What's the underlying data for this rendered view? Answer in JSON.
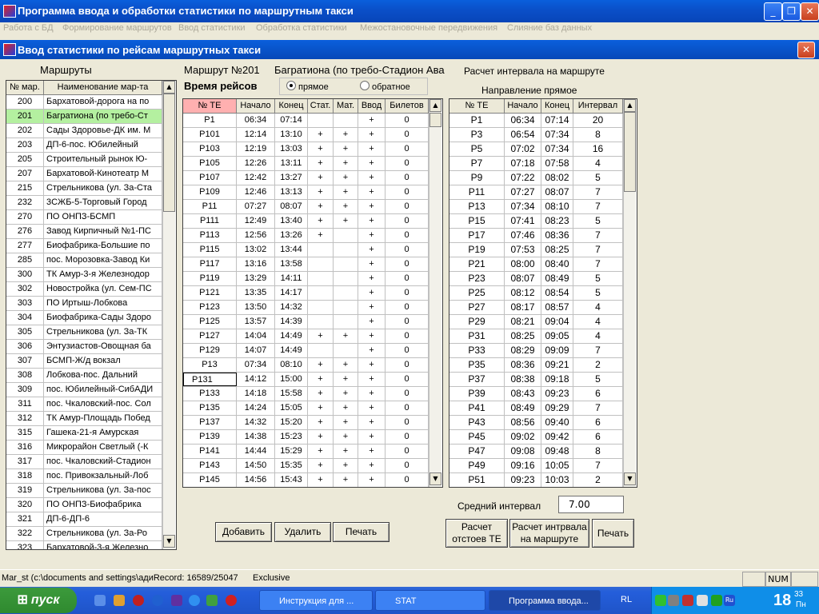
{
  "app": {
    "title": "Программа ввода и обработки статистики по маршрутным такси",
    "menu": [
      "Работа с БД",
      "Формирование маршрутов",
      "Ввод статистики",
      "Обработка статистики",
      "Межостановочные передвижения",
      "Слияние баз данных"
    ]
  },
  "child": {
    "title": "Ввод статистики по рейсам маршрутных такси"
  },
  "routes": {
    "label": "Маршруты",
    "col_num": "№ мар.",
    "col_name": "Наименование мар-та",
    "selected_index": 1,
    "items": [
      [
        "200",
        "Бархатовой-дорога на по"
      ],
      [
        "201",
        "Багратиона (по требо-Ст"
      ],
      [
        "202",
        "Сады Здоровье-ДК им. М"
      ],
      [
        "203",
        "ДП-6-пос. Юбилейный"
      ],
      [
        "205",
        "Строительный рынок Ю-"
      ],
      [
        "207",
        "Бархатовой-Кинотеатр М"
      ],
      [
        "215",
        "Стрельникова (ул. За-Ста"
      ],
      [
        "232",
        "3СЖБ-5-Торговый Город"
      ],
      [
        "270",
        "ПО ОНПЗ-БСМП"
      ],
      [
        "276",
        "Завод Кирпичный №1-ПС"
      ],
      [
        "277",
        "Биофабрика-Большие по"
      ],
      [
        "285",
        "пос. Морозовка-Завод Ки"
      ],
      [
        "300",
        "ТК Амур-3-я Железнодор"
      ],
      [
        "302",
        "Новостройка (ул. Сем-ПС"
      ],
      [
        "303",
        "ПО Иртыш-Лобкова"
      ],
      [
        "304",
        "Биофабрика-Сады Здоро"
      ],
      [
        "305",
        "Стрельникова (ул. За-ТК"
      ],
      [
        "306",
        "Энтузиастов-Овощная ба"
      ],
      [
        "307",
        "БСМП-Ж/д вокзал"
      ],
      [
        "308",
        "Лобкова-пос. Дальний"
      ],
      [
        "309",
        "пос. Юбилейный-СибАДИ"
      ],
      [
        "311",
        "пос. Чкаловский-пос. Сол"
      ],
      [
        "312",
        "ТК Амур-Площадь Побед"
      ],
      [
        "315",
        "Гашека-21-я Амурская"
      ],
      [
        "316",
        "Микрорайон Светлый (-К"
      ],
      [
        "317",
        "пос. Чкаловский-Стадион"
      ],
      [
        "318",
        "пос. Привокзальный-Лоб"
      ],
      [
        "319",
        "Стрельникова (ул. За-пос"
      ],
      [
        "320",
        "ПО ОНПЗ-Биофабрика"
      ],
      [
        "321",
        "ДП-6-ДП-6"
      ],
      [
        "322",
        "Стрельникова (ул. За-Ро"
      ],
      [
        "323",
        "Бархатовой-3-я Железно"
      ]
    ]
  },
  "route_header": {
    "number": "Маршрут №201",
    "name": "Багратиона (по требо-Стадион Ава",
    "interval_title": "Расчет интервала на маршруте"
  },
  "trips": {
    "label": "Время рейсов",
    "direction_forward": "прямое",
    "direction_back": "обратное",
    "selected_direction": "прямое",
    "columns": [
      "№ ТЕ",
      "Начало",
      "Конец",
      "Стат.",
      "Мат.",
      "Ввод",
      "Билетов"
    ],
    "rows": [
      [
        "P1",
        "06:34",
        "07:14",
        "",
        "",
        "+",
        "0"
      ],
      [
        "P101",
        "12:14",
        "13:10",
        "+",
        "+",
        "+",
        "0"
      ],
      [
        "P103",
        "12:19",
        "13:03",
        "+",
        "+",
        "+",
        "0"
      ],
      [
        "P105",
        "12:26",
        "13:11",
        "+",
        "+",
        "+",
        "0"
      ],
      [
        "P107",
        "12:42",
        "13:27",
        "+",
        "+",
        "+",
        "0"
      ],
      [
        "P109",
        "12:46",
        "13:13",
        "+",
        "+",
        "+",
        "0"
      ],
      [
        "P11",
        "07:27",
        "08:07",
        "+",
        "+",
        "+",
        "0"
      ],
      [
        "P111",
        "12:49",
        "13:40",
        "+",
        "+",
        "+",
        "0"
      ],
      [
        "P113",
        "12:56",
        "13:26",
        "+",
        "",
        "+",
        "0"
      ],
      [
        "P115",
        "13:02",
        "13:44",
        "",
        "",
        "+",
        "0"
      ],
      [
        "P117",
        "13:16",
        "13:58",
        "",
        "",
        "+",
        "0"
      ],
      [
        "P119",
        "13:29",
        "14:11",
        "",
        "",
        "+",
        "0"
      ],
      [
        "P121",
        "13:35",
        "14:17",
        "",
        "",
        "+",
        "0"
      ],
      [
        "P123",
        "13:50",
        "14:32",
        "",
        "",
        "+",
        "0"
      ],
      [
        "P125",
        "13:57",
        "14:39",
        "",
        "",
        "+",
        "0"
      ],
      [
        "P127",
        "14:04",
        "14:49",
        "+",
        "+",
        "+",
        "0"
      ],
      [
        "P129",
        "14:07",
        "14:49",
        "",
        "",
        "+",
        "0"
      ],
      [
        "P13",
        "07:34",
        "08:10",
        "+",
        "+",
        "+",
        "0"
      ],
      [
        "P131",
        "14:12",
        "15:00",
        "+",
        "+",
        "+",
        "0"
      ],
      [
        "P133",
        "14:18",
        "15:58",
        "+",
        "+",
        "+",
        "0"
      ],
      [
        "P135",
        "14:24",
        "15:05",
        "+",
        "+",
        "+",
        "0"
      ],
      [
        "P137",
        "14:32",
        "15:20",
        "+",
        "+",
        "+",
        "0"
      ],
      [
        "P139",
        "14:38",
        "15:23",
        "+",
        "+",
        "+",
        "0"
      ],
      [
        "P141",
        "14:44",
        "15:29",
        "+",
        "+",
        "+",
        "0"
      ],
      [
        "P143",
        "14:50",
        "15:35",
        "+",
        "+",
        "+",
        "0"
      ],
      [
        "P145",
        "14:56",
        "15:43",
        "+",
        "+",
        "+",
        "0"
      ]
    ],
    "editing_row": 18
  },
  "interval": {
    "direction_label": "Направление прямое",
    "columns": [
      "№ ТЕ",
      "Начало",
      "Конец",
      "Интервал"
    ],
    "rows": [
      [
        "P1",
        "06:34",
        "07:14",
        "20"
      ],
      [
        "P3",
        "06:54",
        "07:34",
        "8"
      ],
      [
        "P5",
        "07:02",
        "07:34",
        "16"
      ],
      [
        "P7",
        "07:18",
        "07:58",
        "4"
      ],
      [
        "P9",
        "07:22",
        "08:02",
        "5"
      ],
      [
        "P11",
        "07:27",
        "08:07",
        "7"
      ],
      [
        "P13",
        "07:34",
        "08:10",
        "7"
      ],
      [
        "P15",
        "07:41",
        "08:23",
        "5"
      ],
      [
        "P17",
        "07:46",
        "08:36",
        "7"
      ],
      [
        "P19",
        "07:53",
        "08:25",
        "7"
      ],
      [
        "P21",
        "08:00",
        "08:40",
        "7"
      ],
      [
        "P23",
        "08:07",
        "08:49",
        "5"
      ],
      [
        "P25",
        "08:12",
        "08:54",
        "5"
      ],
      [
        "P27",
        "08:17",
        "08:57",
        "4"
      ],
      [
        "P29",
        "08:21",
        "09:04",
        "4"
      ],
      [
        "P31",
        "08:25",
        "09:05",
        "4"
      ],
      [
        "P33",
        "08:29",
        "09:09",
        "7"
      ],
      [
        "P35",
        "08:36",
        "09:21",
        "2"
      ],
      [
        "P37",
        "08:38",
        "09:18",
        "5"
      ],
      [
        "P39",
        "08:43",
        "09:23",
        "6"
      ],
      [
        "P41",
        "08:49",
        "09:29",
        "7"
      ],
      [
        "P43",
        "08:56",
        "09:40",
        "6"
      ],
      [
        "P45",
        "09:02",
        "09:42",
        "6"
      ],
      [
        "P47",
        "09:08",
        "09:48",
        "8"
      ],
      [
        "P49",
        "09:16",
        "10:05",
        "7"
      ],
      [
        "P51",
        "09:23",
        "10:03",
        "2"
      ]
    ],
    "avg_label": "Средний интервал",
    "avg_value": "7.00"
  },
  "buttons": {
    "add": "Добавить",
    "delete": "Удалить",
    "print1": "Печать",
    "calc_te_1": "Расчет",
    "calc_te_2": "отстоев ТЕ",
    "calc_int_1": "Расчет интрвала",
    "calc_int_2": "на маршруте",
    "print2": "Печать"
  },
  "status": {
    "path": "Mar_st (c:\\documents and settings\\адиRecord: 16589/25047",
    "mode": "Exclusive",
    "num": "NUM"
  },
  "taskbar": {
    "start": "пуск",
    "items": [
      "Инструкция для ...",
      "STAT",
      "Программа ввода..."
    ],
    "lang": "RL",
    "time_hour": "18",
    "time_min": "33",
    "day": "Пн",
    "keyboard": "Ru"
  },
  "colors": {
    "selected_row": "#b4f0a0",
    "header_highlight": "#ffb0b0",
    "xp_blue": "#0a5fdc"
  }
}
